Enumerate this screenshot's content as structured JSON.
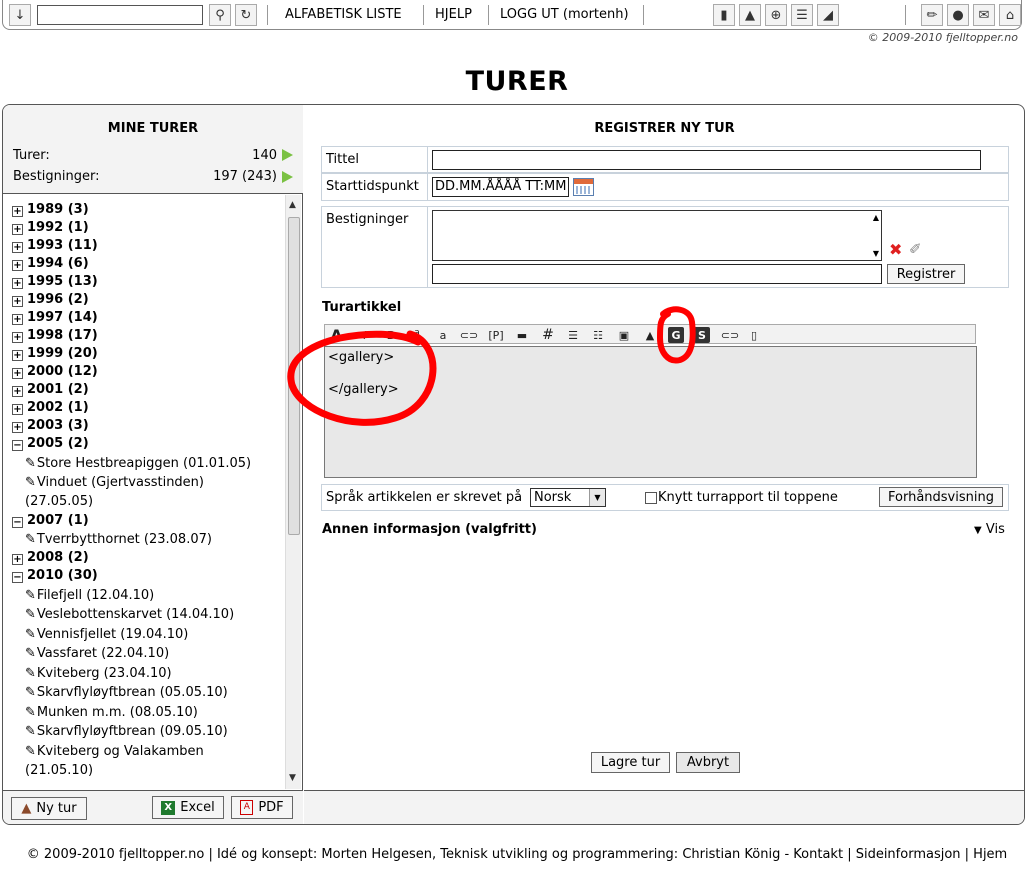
{
  "topbar": {
    "links": [
      "ALFABETISK LISTE",
      "HJELP",
      "LOGG UT (mortenh)"
    ],
    "search_value": "",
    "copyright": "© 2009-2010 fjelltopper.no"
  },
  "page_title": "TURER",
  "mine_turer": {
    "title": "MINE TURER",
    "turer_label": "Turer:",
    "turer_value": "140",
    "bestig_label": "Bestigninger:",
    "bestig_value": "197 (243)"
  },
  "tree": {
    "years": [
      {
        "label": "1989 (3)",
        "expanded": false
      },
      {
        "label": "1992 (1)",
        "expanded": false
      },
      {
        "label": "1993 (11)",
        "expanded": false
      },
      {
        "label": "1994 (6)",
        "expanded": false
      },
      {
        "label": "1995 (13)",
        "expanded": false
      },
      {
        "label": "1996 (2)",
        "expanded": false
      },
      {
        "label": "1997 (14)",
        "expanded": false
      },
      {
        "label": "1998 (17)",
        "expanded": false
      },
      {
        "label": "1999 (20)",
        "expanded": false
      },
      {
        "label": "2000 (12)",
        "expanded": false
      },
      {
        "label": "2001 (2)",
        "expanded": false
      },
      {
        "label": "2002 (1)",
        "expanded": false
      },
      {
        "label": "2003 (3)",
        "expanded": false
      },
      {
        "label": "2005 (2)",
        "expanded": true
      },
      {
        "label": "2007 (1)",
        "expanded": true
      },
      {
        "label": "2008 (2)",
        "expanded": false
      },
      {
        "label": "2010 (30)",
        "expanded": true
      }
    ],
    "trips_2005": [
      "Store Hestbreapiggen (01.01.05)",
      "Vinduet (Gjertvasstinden)",
      "(27.05.05)"
    ],
    "trips_2007": [
      "Tverrbytthornet (23.08.07)"
    ],
    "trips_2010": [
      "Filefjell (12.04.10)",
      "Veslebottenskarvet (14.04.10)",
      "Vennisfjellet (19.04.10)",
      "Vassfaret (22.04.10)",
      "Kviteberg (23.04.10)",
      "Skarvflyløyftbrean (05.05.10)",
      "Munken m.m. (08.05.10)",
      "Skarvflyløyftbrean (09.05.10)",
      "Kviteberg og Valakamben",
      "(21.05.10)"
    ]
  },
  "left_footer": {
    "ny_tur": "Ny tur",
    "excel": "Excel",
    "pdf": "PDF"
  },
  "form": {
    "title": "REGISTRER NY TUR",
    "tittel_label": "Tittel",
    "tittel_value": "",
    "start_label": "Starttidspunkt",
    "start_value": "DD.MM.ÅÅÅÅ TT:MM",
    "bestig_label": "Bestigninger",
    "registrer_button": "Registrer",
    "turartikkel_label": "Turartikkel",
    "editor_line1": "<gallery>",
    "editor_line2": "</gallery>",
    "lang_label": "Språk artikkelen er skrevet på",
    "lang_value": "Norsk",
    "knytt_label": "Knytt turrapport til toppene",
    "knytt_checked": false,
    "preview_button": "Forhåndsvisning",
    "annen_label": "Annen informasjon (valgfritt)",
    "vis_label": "Vis",
    "lagre_button": "Lagre tur",
    "avbryt_button": "Avbryt"
  },
  "footer_text": "© 2009-2010 fjelltopper.no | Idé og konsept: Morten Helgesen, Teknisk utvikling og programmering: Christian König  -  Kontakt | Sideinformasjon | Hjem",
  "colors": {
    "accent_arrow": "#7ac142",
    "annotation": "#ff0000",
    "panel_bg": "#f3f3f3"
  }
}
